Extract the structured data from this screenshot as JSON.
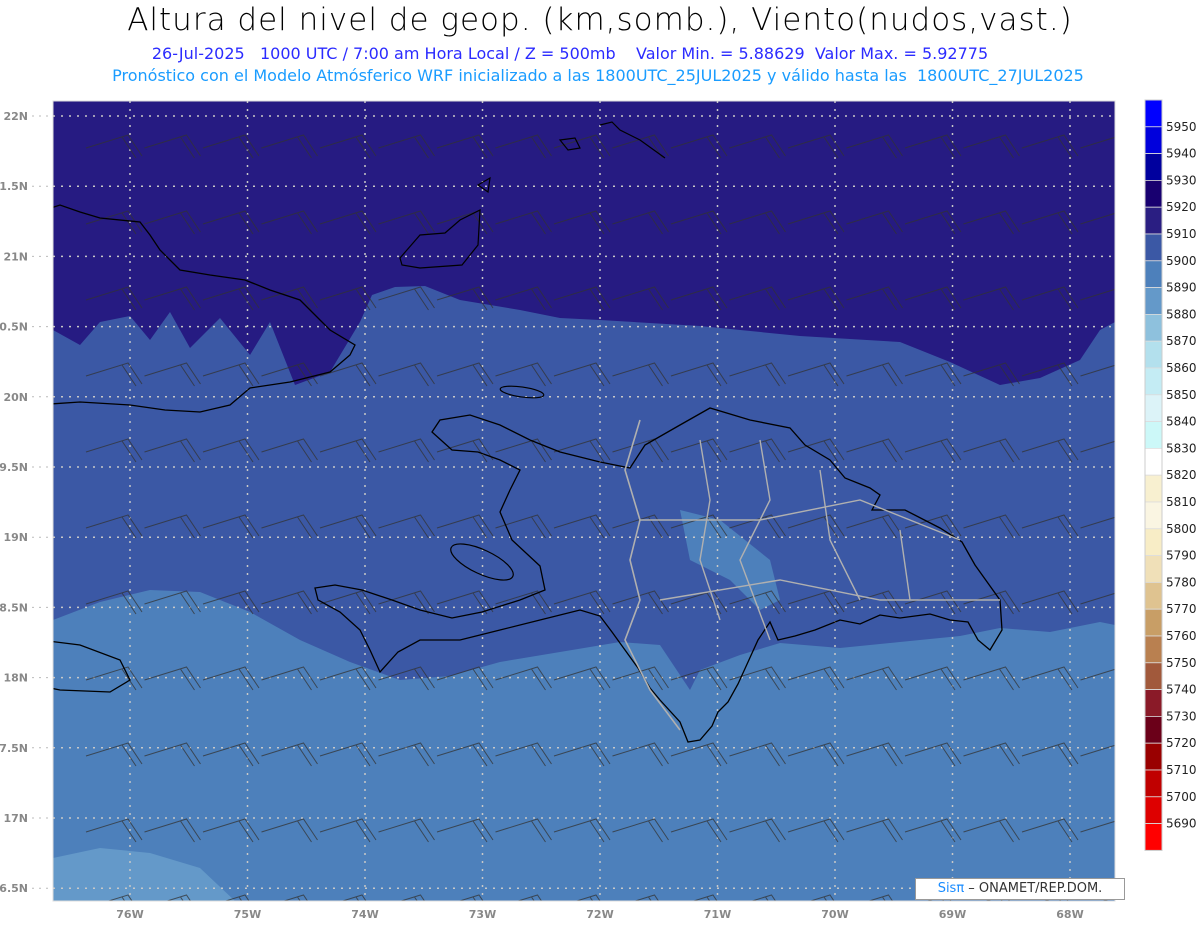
{
  "header": {
    "title": "Altura del nivel de geop. (km,somb.), Viento(nudos,vast.)",
    "subtitle": "26-Jul-2025   1000 UTC / 7:00 am Hora Local / Z = 500mb    Valor Min. = 5.88629  Valor Max. = 5.92775",
    "model_line": "Pronóstico con el Modelo Atmósferico WRF inicializado a las 1800UTC_25JUL2025 y válido hasta las  1800UTC_27JUL2025"
  },
  "map": {
    "lat_labels": [
      "22N",
      "1.5N",
      "21N",
      "0.5N",
      "20N",
      "9.5N",
      "19N",
      "8.5N",
      "18N",
      "7.5N",
      "17N",
      "6.5N"
    ],
    "lon_labels": [
      "76W",
      "75W",
      "74W",
      "73W",
      "72W",
      "71W",
      "70W",
      "69W",
      "68W"
    ],
    "fill_colors": {
      "band_5910_5920": "#261b82",
      "band_5900_5910": "#3b58a5",
      "band_5890_5900": "#4d80bb",
      "band_5880_5890": "#6499c9"
    },
    "coastline_color": "#000000",
    "province_border_color": "#b0b0b0",
    "grid": "dotted"
  },
  "colorbar": {
    "labels": [
      "5950",
      "5940",
      "5930",
      "5920",
      "5910",
      "5900",
      "5890",
      "5880",
      "5870",
      "5860",
      "5850",
      "5840",
      "5830",
      "5820",
      "5810",
      "5800",
      "5790",
      "5780",
      "5770",
      "5760",
      "5750",
      "5740",
      "5730",
      "5720",
      "5710",
      "5700",
      "5690"
    ],
    "colors": [
      "#0000ff",
      "#0000dc",
      "#00009e",
      "#180070",
      "#2a1e82",
      "#3b58a5",
      "#4d80bb",
      "#6499c9",
      "#8ec1dd",
      "#b3e0ed",
      "#c4ecf4",
      "#dcf3f8",
      "#ccf8f8",
      "#ffffff",
      "#f8f0d0",
      "#faf5e2",
      "#f8edc6",
      "#f0e0b8",
      "#dfc390",
      "#c89e66",
      "#b98050",
      "#a1593b",
      "#8a1a28",
      "#6b0019",
      "#990000",
      "#c00000",
      "#de0000",
      "#ff0000"
    ]
  },
  "logo": {
    "sis": "Sisπ",
    "text": " – ONAMET/REP.DOM."
  }
}
